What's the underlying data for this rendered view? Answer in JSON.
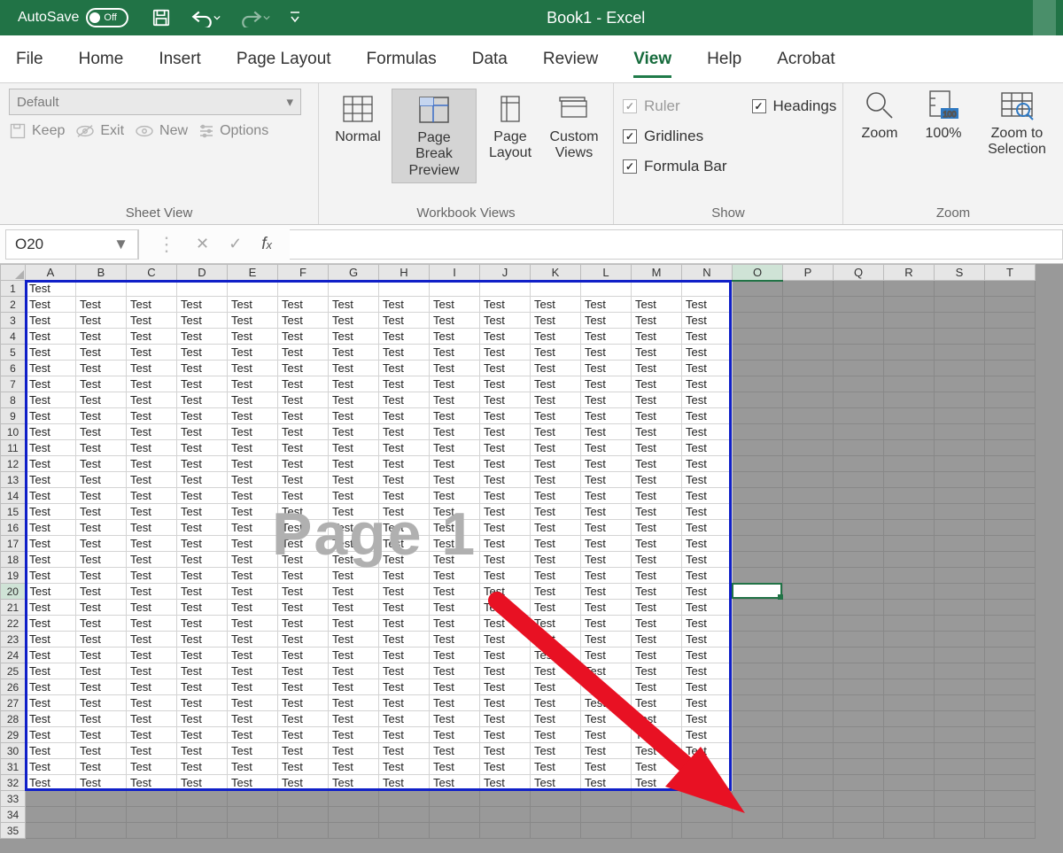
{
  "title": "Book1 - Excel",
  "autosave": {
    "label": "AutoSave",
    "state": "Off"
  },
  "tabs": [
    "File",
    "Home",
    "Insert",
    "Page Layout",
    "Formulas",
    "Data",
    "Review",
    "View",
    "Help",
    "Acrobat"
  ],
  "active_tab": "View",
  "sheet_view": {
    "dropdown": "Default",
    "keep": "Keep",
    "exit": "Exit",
    "new": "New",
    "options": "Options",
    "group_label": "Sheet View"
  },
  "workbook_views": {
    "normal": "Normal",
    "page_break": "Page Break Preview",
    "page_layout": "Page Layout",
    "custom": "Custom Views",
    "group_label": "Workbook Views"
  },
  "show": {
    "ruler": "Ruler",
    "gridlines": "Gridlines",
    "formula_bar": "Formula Bar",
    "headings": "Headings",
    "group_label": "Show"
  },
  "zoom": {
    "zoom": "Zoom",
    "hundred": "100%",
    "to_sel": "Zoom to Selection",
    "group_label": "Zoom"
  },
  "namebox": "O20",
  "columns": [
    "A",
    "B",
    "C",
    "D",
    "E",
    "F",
    "G",
    "H",
    "I",
    "J",
    "K",
    "L",
    "M",
    "N",
    "O",
    "P",
    "Q",
    "R",
    "S",
    "T"
  ],
  "row_count": 35,
  "cell_value": "Test",
  "watermark": "Page 1",
  "sel_col": "O",
  "sel_row": 20,
  "data_cols": 14,
  "data_rows": 32
}
